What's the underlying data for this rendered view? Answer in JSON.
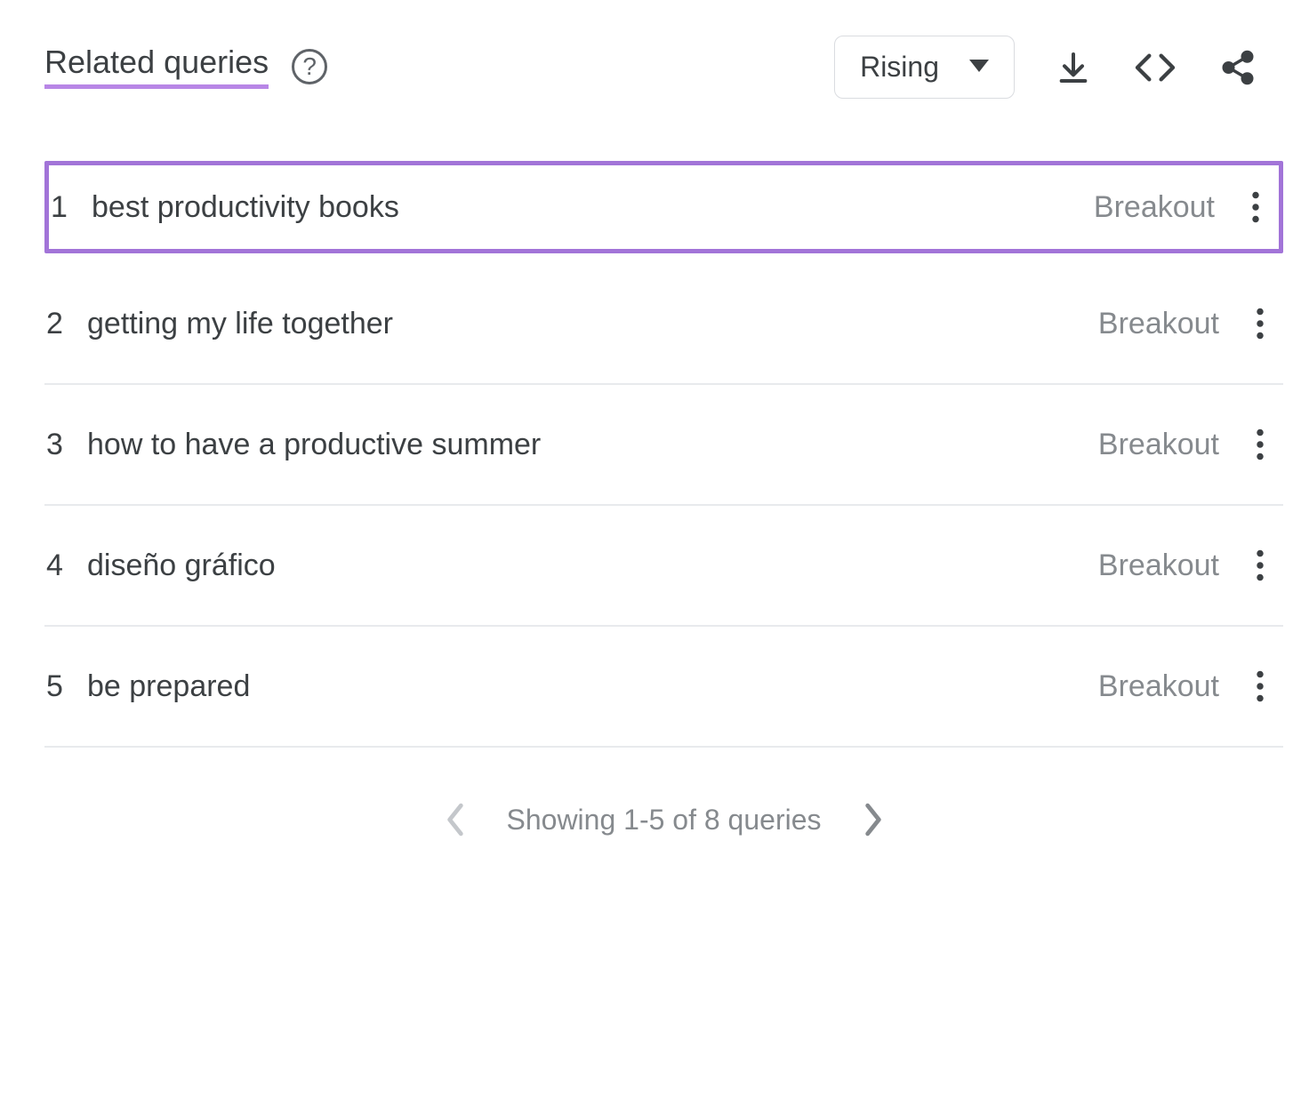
{
  "header": {
    "title": "Related queries",
    "dropdown_label": "Rising"
  },
  "queries": [
    {
      "rank": "1",
      "text": "best productivity books",
      "status": "Breakout",
      "highlight": true
    },
    {
      "rank": "2",
      "text": "getting my life together",
      "status": "Breakout",
      "highlight": false
    },
    {
      "rank": "3",
      "text": "how to have a productive summer",
      "status": "Breakout",
      "highlight": false
    },
    {
      "rank": "4",
      "text": "diseño gráfico",
      "status": "Breakout",
      "highlight": false
    },
    {
      "rank": "5",
      "text": "be prepared",
      "status": "Breakout",
      "highlight": false
    }
  ],
  "footer": {
    "pagination_text": "Showing 1-5 of 8 queries"
  }
}
